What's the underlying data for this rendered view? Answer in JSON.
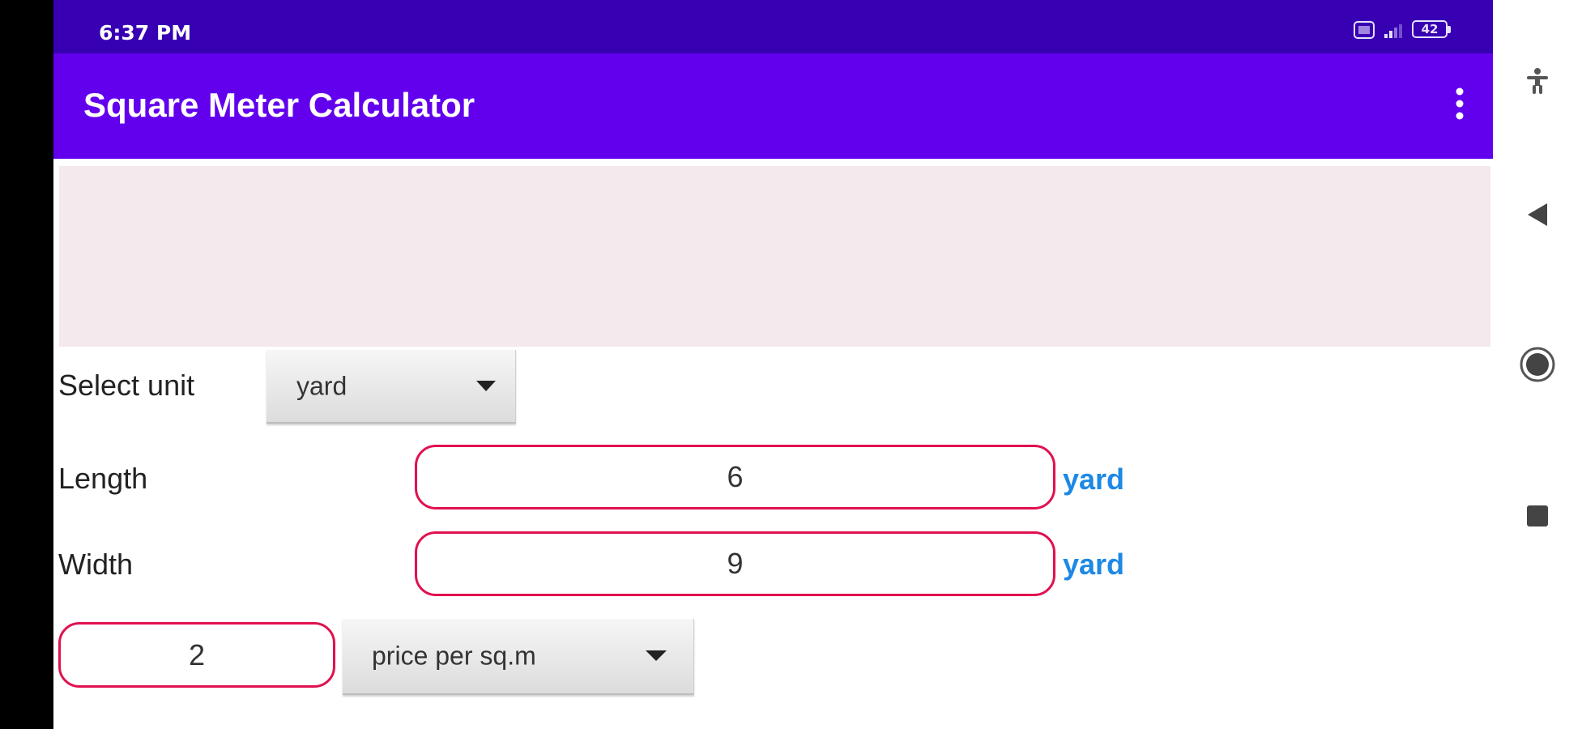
{
  "status_bar": {
    "time": "6:37 PM",
    "battery_level": "42"
  },
  "app_bar": {
    "title": "Square Meter Calculator"
  },
  "form": {
    "select_unit_label": "Select unit",
    "unit_selected": "yard",
    "length_label": "Length",
    "length_value": "6",
    "length_unit": "yard",
    "width_label": "Width",
    "width_value": "9",
    "width_unit": "yard",
    "price_value": "2",
    "price_type_selected": "price per sq.m"
  },
  "colors": {
    "status_bar": "#3700b3",
    "app_bar": "#6200ee",
    "banner_area": "#f4e9ec",
    "field_border": "#e0114f",
    "unit_text": "#1e88e5"
  },
  "icons": {
    "overflow": "more-vert-icon",
    "nav": [
      "accessibility-icon",
      "back-icon",
      "home-icon",
      "recents-icon"
    ]
  }
}
